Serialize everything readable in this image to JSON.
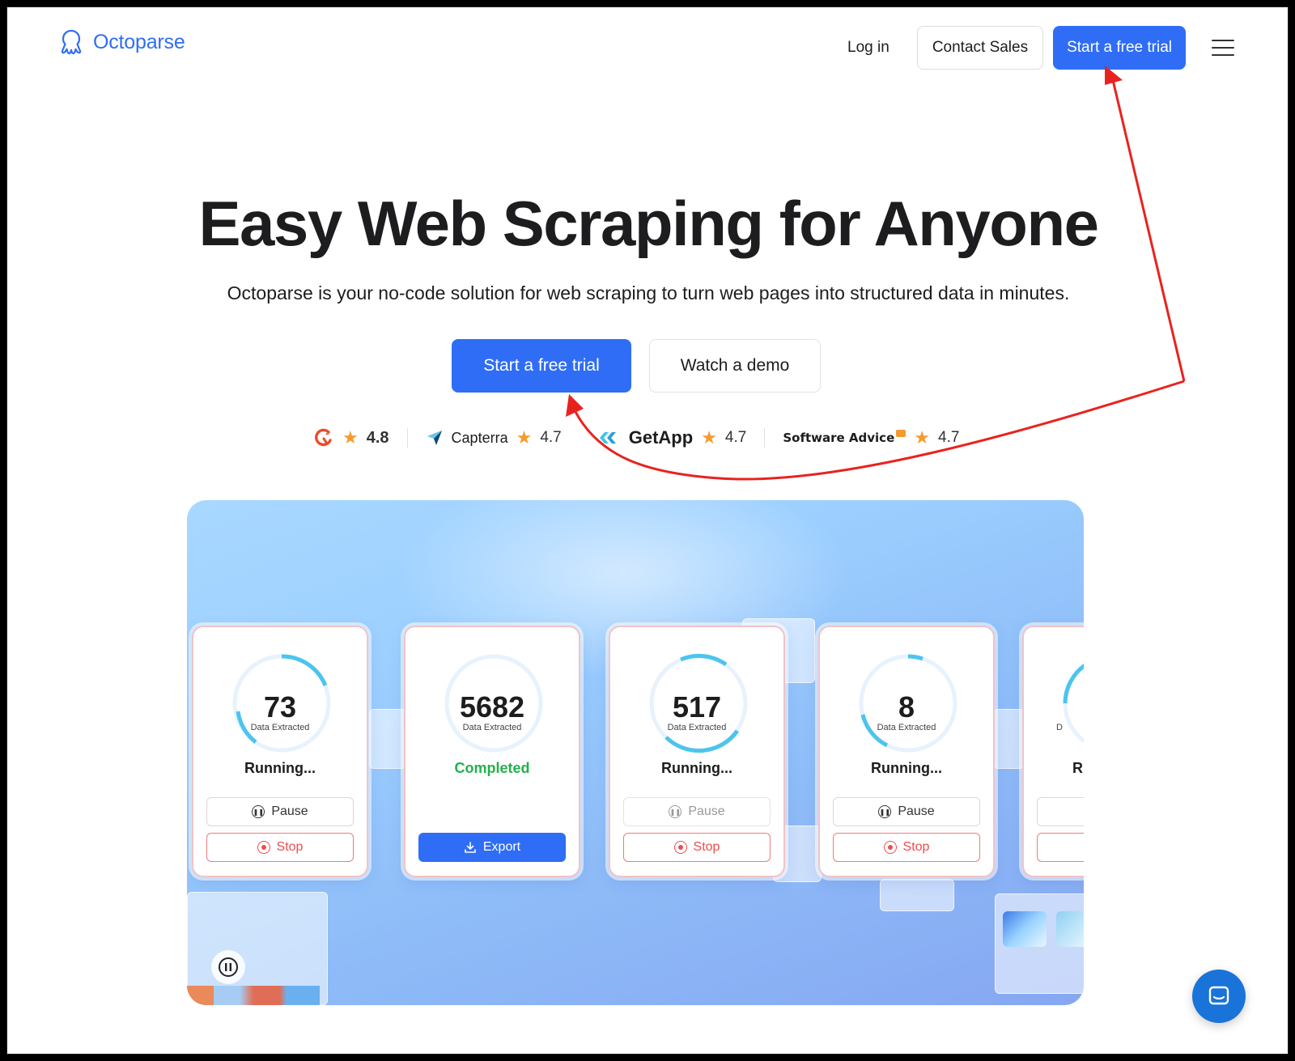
{
  "header": {
    "logo_text": "Octoparse",
    "login": "Log in",
    "contact_sales": "Contact Sales",
    "start_trial": "Start a free trial"
  },
  "hero": {
    "title": "Easy Web Scraping for Anyone",
    "subtitle": "Octoparse is your no-code solution for web scraping to turn web pages into structured data in minutes.",
    "cta_primary": "Start a free trial",
    "cta_secondary": "Watch a demo"
  },
  "ratings": [
    {
      "brand": "G2",
      "score": "4.8"
    },
    {
      "brand": "Capterra",
      "score": "4.7"
    },
    {
      "brand": "GetApp",
      "score": "4.7"
    },
    {
      "brand": "Software Advice",
      "score": "4.7"
    }
  ],
  "cards": [
    {
      "value": "73",
      "label": "Data Extracted",
      "status": "Running...",
      "pause": "Pause",
      "stop": "Stop"
    },
    {
      "value": "5682",
      "label": "Data Extracted",
      "status": "Completed",
      "export": "Export"
    },
    {
      "value": "517",
      "label": "Data Extracted",
      "status": "Running...",
      "pause": "Pause",
      "stop": "Stop"
    },
    {
      "value": "8",
      "label": "Data Extracted",
      "status": "Running...",
      "pause": "Pause",
      "stop": "Stop"
    },
    {
      "label": "D",
      "status": "R"
    }
  ],
  "colors": {
    "brand_blue": "#2f6df6",
    "stop_red": "#ee4d4d",
    "completed_green": "#23b14d",
    "star_orange": "#f79a2e",
    "annotation_red": "#e8231f"
  }
}
